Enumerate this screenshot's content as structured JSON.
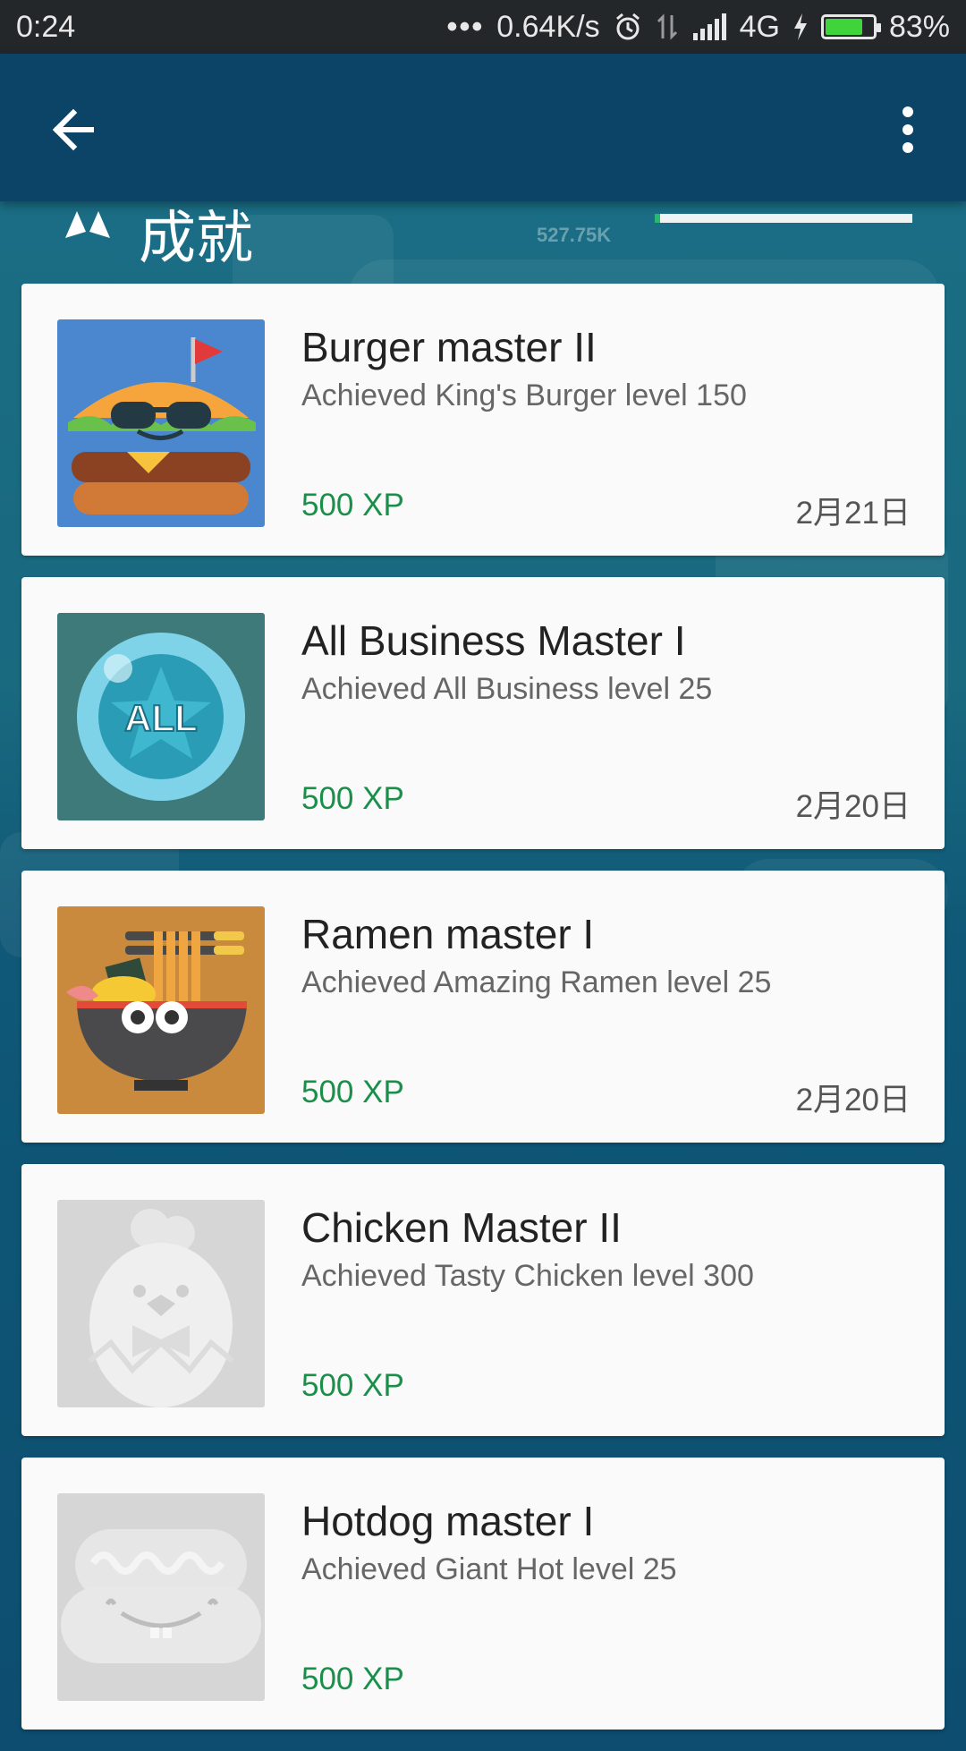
{
  "status_bar": {
    "time": "0:24",
    "speed": "0.64K/s",
    "network": "4G",
    "battery": "83%",
    "battery_level": 0.83
  },
  "header": {
    "title": "成就",
    "score": "527.75K",
    "progress": 0.02
  },
  "achievements": [
    {
      "title": "Burger master II",
      "description": "Achieved King's Burger level 150",
      "xp": "500 XP",
      "date": "2月21日",
      "icon": "burger-icon",
      "unlocked": true
    },
    {
      "title": "All Business Master I",
      "description": "Achieved All Business level 25",
      "xp": "500 XP",
      "date": "2月20日",
      "icon": "all-star-coin-icon",
      "unlocked": true
    },
    {
      "title": "Ramen master I",
      "description": "Achieved Amazing Ramen level 25",
      "xp": "500 XP",
      "date": "2月20日",
      "icon": "ramen-bowl-icon",
      "unlocked": true
    },
    {
      "title": "Chicken Master II",
      "description": "Achieved Tasty Chicken level 300",
      "xp": "500 XP",
      "date": "",
      "icon": "chicken-icon",
      "unlocked": false
    },
    {
      "title": "Hotdog master I",
      "description": "Achieved Giant Hot level 25",
      "xp": "500 XP",
      "date": "",
      "icon": "hotdog-icon",
      "unlocked": false
    }
  ]
}
